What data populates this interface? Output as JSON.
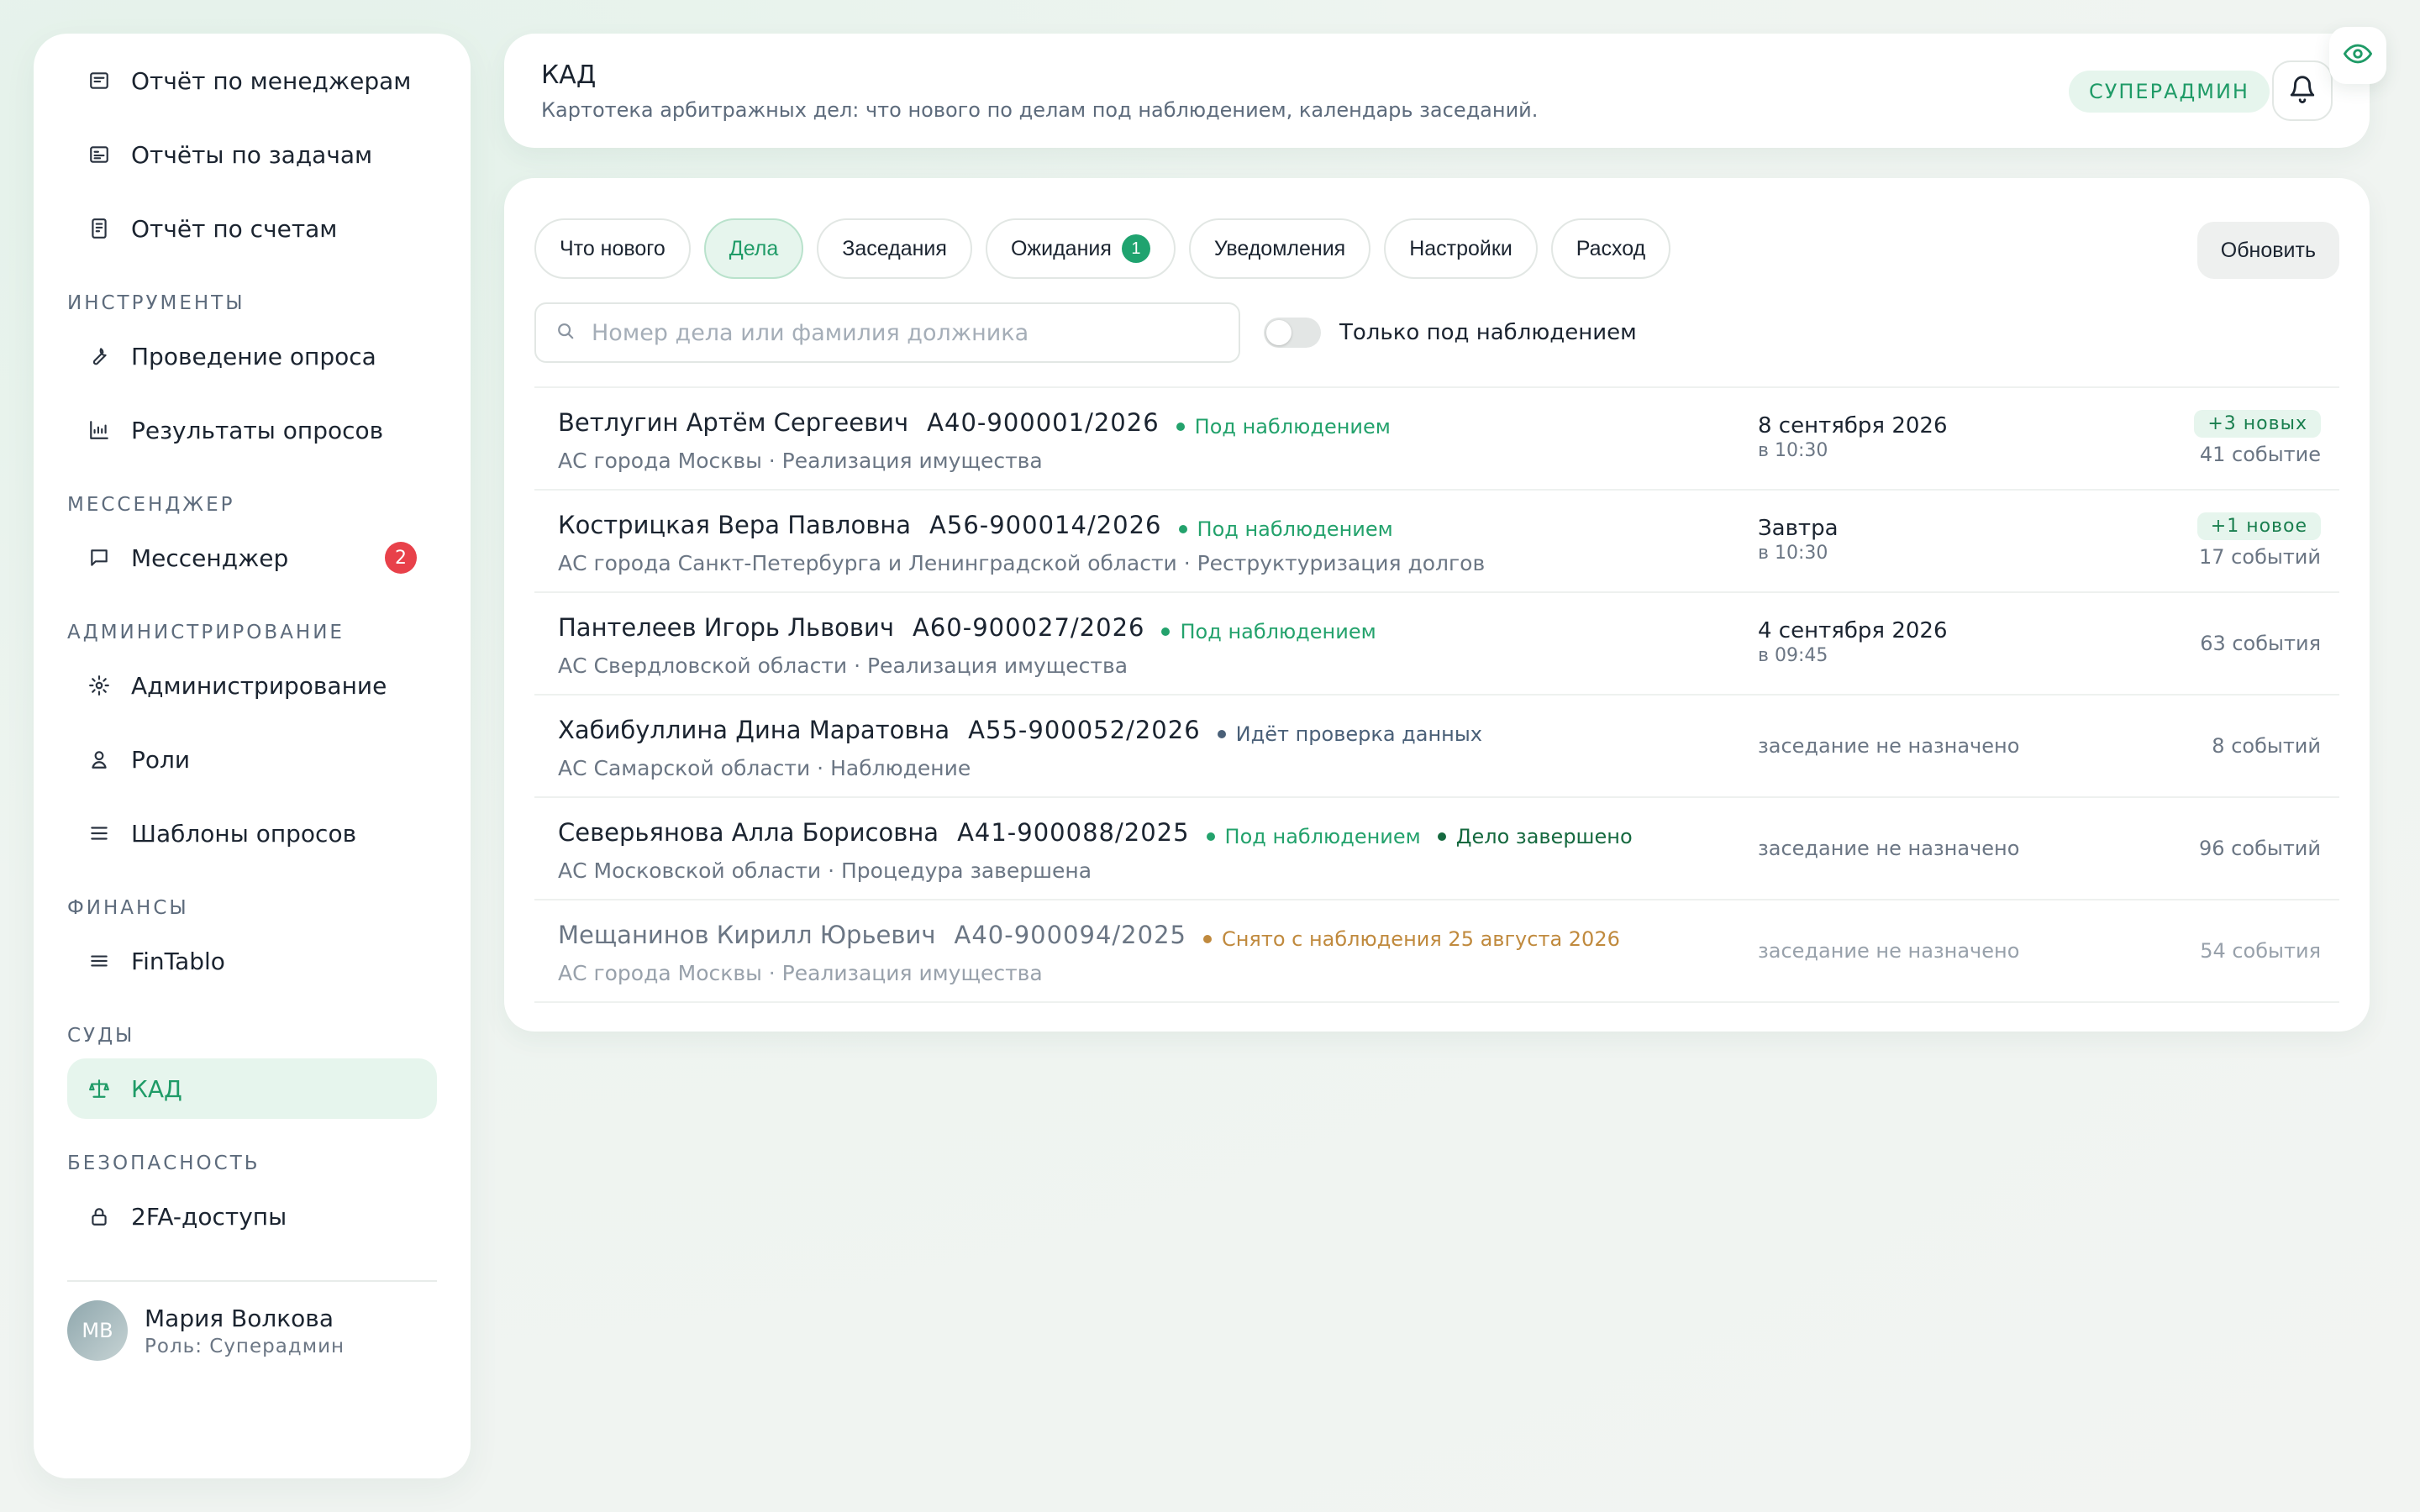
{
  "sidebar": {
    "top_items": [
      {
        "label": "Отчёт по менеджерам",
        "icon": "report-icon"
      },
      {
        "label": "Отчёты по задачам",
        "icon": "tasks-report-icon"
      },
      {
        "label": "Отчёт по счетам",
        "icon": "invoice-report-icon"
      }
    ],
    "sections": [
      {
        "title": "ИНСТРУМЕНТЫ",
        "items": [
          {
            "label": "Проведение опроса",
            "icon": "wrench-icon"
          },
          {
            "label": "Результаты опросов",
            "icon": "chart-icon"
          }
        ]
      },
      {
        "title": "МЕССЕНДЖЕР",
        "items": [
          {
            "label": "Мессенджер",
            "icon": "chat-icon",
            "badge": "2"
          }
        ]
      },
      {
        "title": "АДМИНИСТРИРОВАНИЕ",
        "items": [
          {
            "label": "Администрирование",
            "icon": "gear-icon"
          },
          {
            "label": "Роли",
            "icon": "user-icon"
          },
          {
            "label": "Шаблоны опросов",
            "icon": "list-icon"
          }
        ]
      },
      {
        "title": "ФИНАНСЫ",
        "items": [
          {
            "label": "FinTablo",
            "icon": "menu-icon"
          }
        ]
      },
      {
        "title": "СУДЫ",
        "items": [
          {
            "label": "КАД",
            "icon": "scales-icon",
            "active": true
          }
        ]
      },
      {
        "title": "БЕЗОПАСНОСТЬ",
        "items": [
          {
            "label": "2FA-доступы",
            "icon": "lock-icon"
          }
        ]
      }
    ],
    "user": {
      "initials": "МВ",
      "name": "Мария Волкова",
      "role": "Роль: Суперадмин"
    }
  },
  "header": {
    "title": "КАД",
    "subtitle": "Картотека арбитражных дел: что нового по делам под наблюдением, календарь заседаний.",
    "role_badge": "СУПЕРАДМИН"
  },
  "tabs": [
    {
      "label": "Что нового"
    },
    {
      "label": "Дела",
      "active": true
    },
    {
      "label": "Заседания"
    },
    {
      "label": "Ожидания",
      "count": "1"
    },
    {
      "label": "Уведомления"
    },
    {
      "label": "Настройки"
    },
    {
      "label": "Расход"
    }
  ],
  "refresh_label": "Обновить",
  "search": {
    "placeholder": "Номер дела или фамилия должника",
    "value": ""
  },
  "toggle_label": "Только под наблюдением",
  "colors": {
    "accent": "#1f9b67",
    "badge_red": "#e8414a",
    "status_amber": "#c08a3e"
  },
  "cases": [
    {
      "debtor": "Ветлугин Артём Сергеевич",
      "case_no": "А40-900001/2026",
      "statuses": [
        {
          "text": "Под наблюдением",
          "kind": "green"
        }
      ],
      "court": "АС города Москвы · Реализация имущества",
      "hearing_date": "8 сентября 2026",
      "hearing_time": "в 10:30",
      "new_badge": "+3 новых",
      "events": "41 событие"
    },
    {
      "debtor": "Кострицкая Вера Павловна",
      "case_no": "А56-900014/2026",
      "statuses": [
        {
          "text": "Под наблюдением",
          "kind": "green"
        }
      ],
      "court": "АС города Санкт-Петербурга и Ленинградской области · Реструктуризация долгов",
      "hearing_date": "Завтра",
      "hearing_time": "в 10:30",
      "new_badge": "+1 новое",
      "events": "17 событий"
    },
    {
      "debtor": "Пантелеев Игорь Львович",
      "case_no": "А60-900027/2026",
      "statuses": [
        {
          "text": "Под наблюдением",
          "kind": "green"
        }
      ],
      "court": "АС Свердловской области · Реализация имущества",
      "hearing_date": "4 сентября 2026",
      "hearing_time": "в 09:45",
      "events": "63 события"
    },
    {
      "debtor": "Хабибуллина Дина Маратовна",
      "case_no": "А55-900052/2026",
      "statuses": [
        {
          "text": "Идёт проверка данных",
          "kind": "slate"
        }
      ],
      "court": "АС Самарской области · Наблюдение",
      "hearing_none": "заседание не назначено",
      "events": "8 событий"
    },
    {
      "debtor": "Северьянова Алла Борисовна",
      "case_no": "А41-900088/2025",
      "statuses": [
        {
          "text": "Под наблюдением",
          "kind": "green"
        },
        {
          "text": "Дело завершено",
          "kind": "dark"
        }
      ],
      "court": "АС Московской области · Процедура завершена",
      "hearing_none": "заседание не назначено",
      "events": "96 событий"
    },
    {
      "debtor": "Мещанинов Кирилл Юрьевич",
      "case_no": "А40-900094/2025",
      "statuses": [
        {
          "text": "Снято с наблюдения 25 августа 2026",
          "kind": "amber"
        }
      ],
      "court": "АС города Москвы · Реализация имущества",
      "hearing_none": "заседание не назначено",
      "events": "54 события",
      "muted": true
    }
  ]
}
